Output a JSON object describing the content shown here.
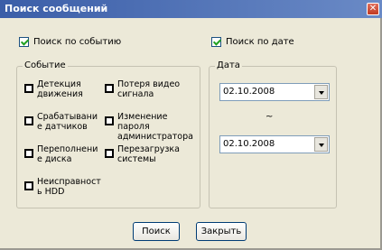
{
  "window": {
    "title": "Поиск сообщений",
    "close_symbol": "✕"
  },
  "search_by_event": {
    "label": "Поиск по событию",
    "checked": true
  },
  "search_by_date": {
    "label": "Поиск по дате",
    "checked": true
  },
  "event_group": {
    "title": "Событие",
    "items": [
      {
        "label": "Детекция движения"
      },
      {
        "label": "Срабатывани е датчиков"
      },
      {
        "label": "Переполнени е диска"
      },
      {
        "label": "Неисправност ь HDD"
      },
      {
        "label": "Потеря видео сигнала"
      },
      {
        "label": "Изменение пароля администратора"
      },
      {
        "label": "Перезагрузка системы"
      }
    ]
  },
  "date_group": {
    "title": "Дата",
    "start_date": "02.10.2008",
    "separator": "~",
    "end_date": "02.10.2008"
  },
  "buttons": {
    "search": "Поиск",
    "close": "Закрыть"
  }
}
